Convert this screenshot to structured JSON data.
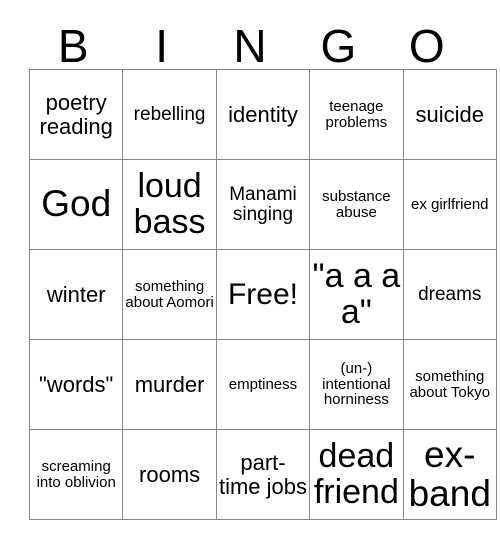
{
  "card": {
    "title_letters": [
      "B",
      "I",
      "N",
      "G",
      "O"
    ],
    "columns": 5,
    "rows": 5,
    "free_space_label": "Free!",
    "free_space_position": {
      "row": 3,
      "col": 3
    },
    "border_color": "#888888",
    "text_color": "#000000",
    "background_color": "#ffffff",
    "cells": [
      [
        {
          "text": "poetry reading",
          "size": "fs-m"
        },
        {
          "text": "rebelling",
          "size": "fs-s"
        },
        {
          "text": "identity",
          "size": "fs-m"
        },
        {
          "text": "teenage problems",
          "size": "fs-xs"
        },
        {
          "text": "suicide",
          "size": "fs-m"
        }
      ],
      [
        {
          "text": "God",
          "size": "fs-xxxl"
        },
        {
          "text": "loud bass",
          "size": "fs-xxl"
        },
        {
          "text": "Manami singing",
          "size": "fs-s"
        },
        {
          "text": "substance abuse",
          "size": "fs-xs"
        },
        {
          "text": "ex girlfriend",
          "size": "fs-xs"
        }
      ],
      [
        {
          "text": "winter",
          "size": "fs-m"
        },
        {
          "text": "something about Aomori",
          "size": "fs-xs"
        },
        {
          "text": "Free!",
          "size": "fs-xl"
        },
        {
          "text": "\"a a a a\"",
          "size": "fs-xxl"
        },
        {
          "text": "dreams",
          "size": "fs-s"
        }
      ],
      [
        {
          "text": "\"words\"",
          "size": "fs-m"
        },
        {
          "text": "murder",
          "size": "fs-m"
        },
        {
          "text": "emptiness",
          "size": "fs-xs"
        },
        {
          "text": "(un-) intentional horniness",
          "size": "fs-xs"
        },
        {
          "text": "something about Tokyo",
          "size": "fs-xs"
        }
      ],
      [
        {
          "text": "screaming into oblivion",
          "size": "fs-xs"
        },
        {
          "text": "rooms",
          "size": "fs-m"
        },
        {
          "text": "part- time jobs",
          "size": "fs-m"
        },
        {
          "text": "dead friend",
          "size": "fs-xxl"
        },
        {
          "text": "ex- band",
          "size": "fs-xxxl"
        }
      ]
    ]
  }
}
